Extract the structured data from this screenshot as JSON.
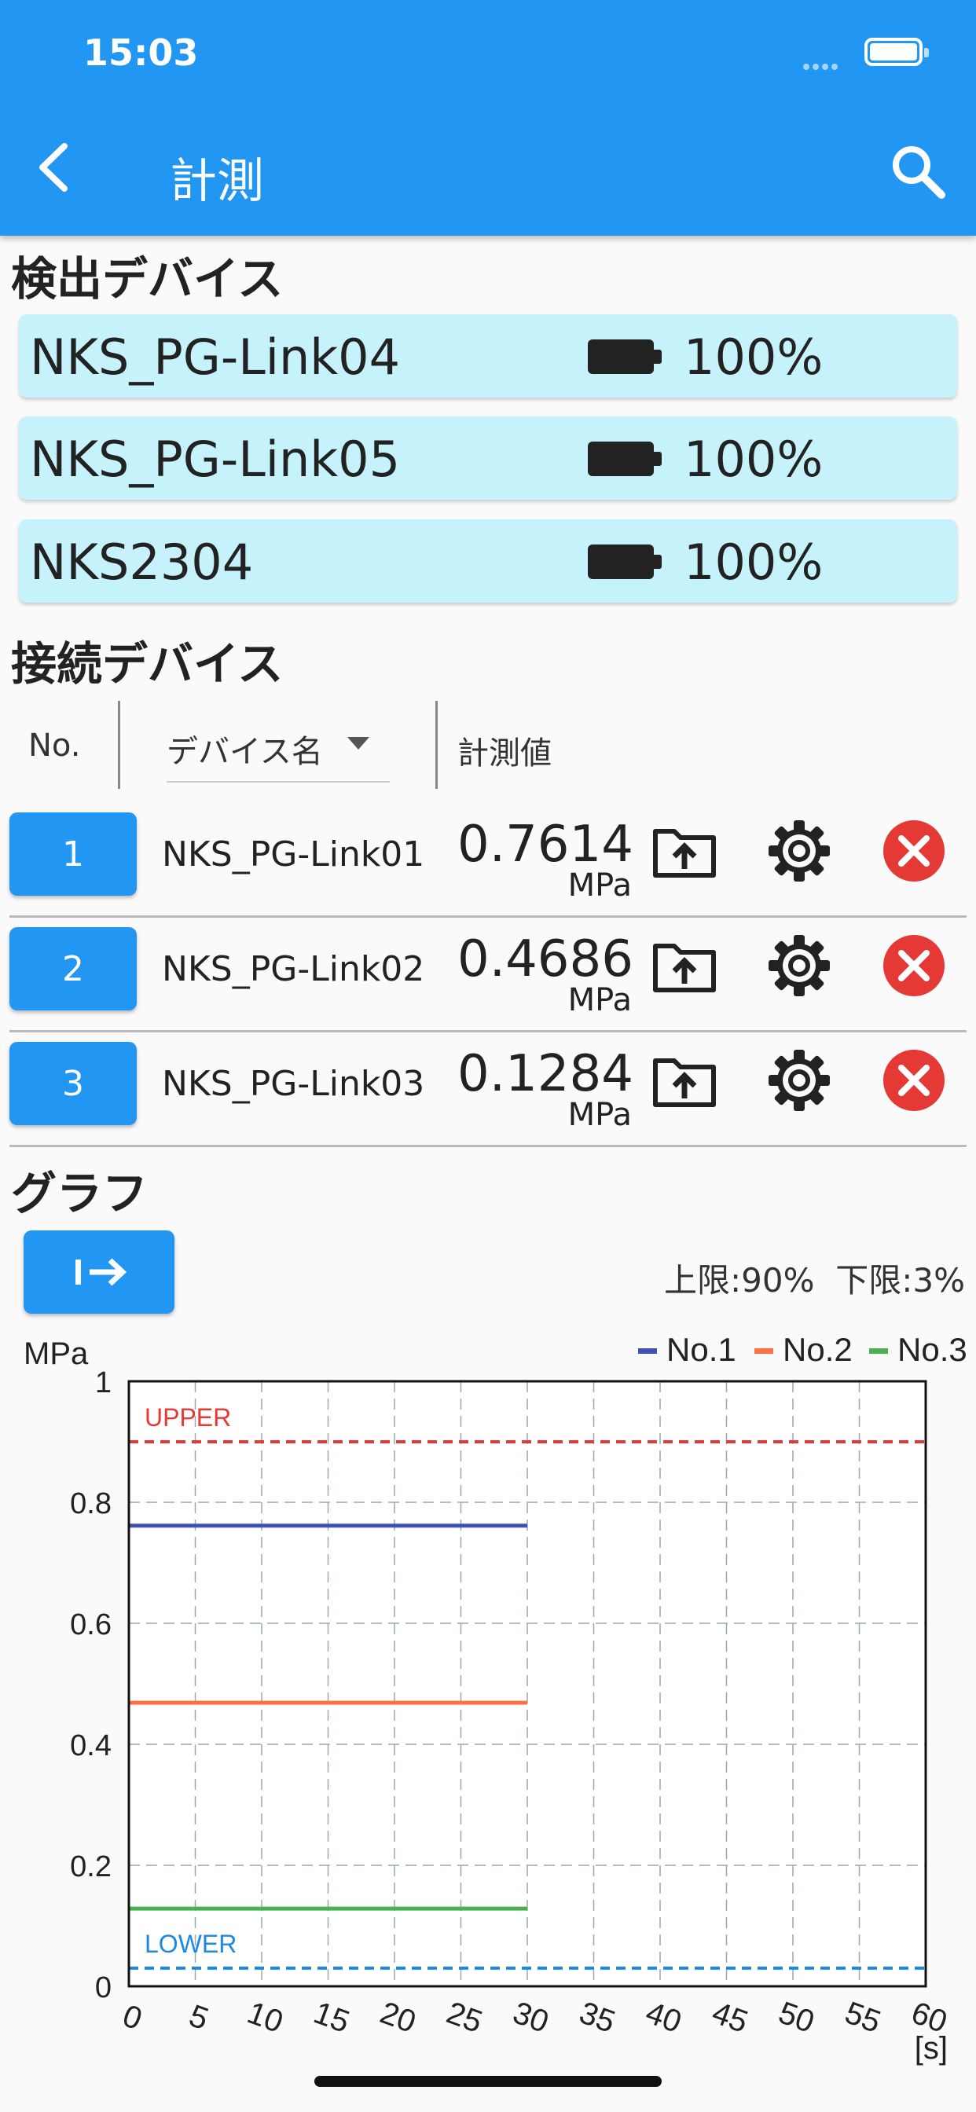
{
  "status_bar": {
    "time": "15:03"
  },
  "header": {
    "title": "計測",
    "back_icon": "chevron-left-icon",
    "search_icon": "search-icon"
  },
  "colors": {
    "primary": "#2196f3",
    "detected_bg": "#c6f2fb",
    "delete": "#e53935"
  },
  "detected": {
    "title": "検出デバイス",
    "items": [
      {
        "name": "NKS_PG-Link04",
        "battery": "100%"
      },
      {
        "name": "NKS_PG-Link05",
        "battery": "100%"
      },
      {
        "name": "NKS2304",
        "battery": "100%"
      }
    ]
  },
  "connected": {
    "title": "接続デバイス",
    "col_no": "No.",
    "col_name": "デバイス名",
    "col_value": "計測値",
    "items": [
      {
        "no": "1",
        "name": "NKS_PG-Link01",
        "value": "0.7614",
        "unit": "MPa"
      },
      {
        "no": "2",
        "name": "NKS_PG-Link02",
        "value": "0.4686",
        "unit": "MPa"
      },
      {
        "no": "3",
        "name": "NKS_PG-Link03",
        "value": "0.1284",
        "unit": "MPa"
      }
    ]
  },
  "graph": {
    "title": "グラフ",
    "follow_icon": "arrow-to-right-icon",
    "limits": "上限:90%  下限:3%"
  },
  "chart_data": {
    "type": "line",
    "ylabel": "MPa",
    "xlabel": "[s]",
    "xlim": [
      0,
      60
    ],
    "ylim": [
      0,
      1
    ],
    "x_ticks": [
      "0",
      "5",
      "10",
      "15",
      "20",
      "25",
      "30",
      "35",
      "40",
      "45",
      "50",
      "55",
      "60"
    ],
    "y_ticks": [
      "0",
      "0.2",
      "0.4",
      "0.6",
      "0.8",
      "1"
    ],
    "grid": true,
    "legend_position": "top-right",
    "series": [
      {
        "name": "No.1",
        "color": "#3f51b5",
        "x": [
          0,
          30
        ],
        "y": [
          0.7614,
          0.7614
        ]
      },
      {
        "name": "No.2",
        "color": "#ff7043",
        "x": [
          0,
          30
        ],
        "y": [
          0.4686,
          0.4686
        ]
      },
      {
        "name": "No.3",
        "color": "#4caf50",
        "x": [
          0,
          30
        ],
        "y": [
          0.1284,
          0.1284
        ]
      }
    ],
    "thresholds": [
      {
        "label": "UPPER",
        "value": 0.9,
        "color": "#e53935"
      },
      {
        "label": "LOWER",
        "value": 0.03,
        "color": "#1e88e5"
      }
    ]
  }
}
